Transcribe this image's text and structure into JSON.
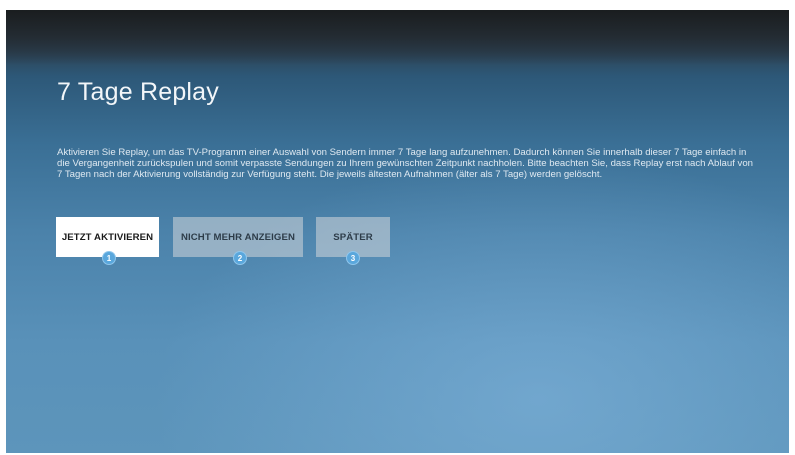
{
  "dialog": {
    "title": "7 Tage Replay",
    "description": "Aktivieren Sie Replay, um das TV-Programm einer Auswahl von Sendern immer 7 Tage lang aufzunehmen. Dadurch können Sie innerhalb dieser 7 Tage einfach in die Vergangenheit zurückspulen und somit verpasste Sendungen zu Ihrem gewünschten Zeitpunkt nachholen. Bitte beachten Sie, dass Replay erst nach Ablauf von 7 Tagen nach der Aktivierung vollständig zur Verfügung steht. Die jeweils ältesten Aufnahmen (älter als 7 Tage) werden gelöscht."
  },
  "buttons": [
    {
      "label": "JETZT AKTIVIEREN",
      "badge": "1",
      "focused": true
    },
    {
      "label": "NICHT MEHR ANZEIGEN",
      "badge": "2",
      "focused": false
    },
    {
      "label": "SPÄTER",
      "badge": "3",
      "focused": false
    }
  ],
  "colors": {
    "focused_button": "#ffffff",
    "unfocused_button": "#a9b8c4",
    "badge": "#5aa7dc"
  }
}
